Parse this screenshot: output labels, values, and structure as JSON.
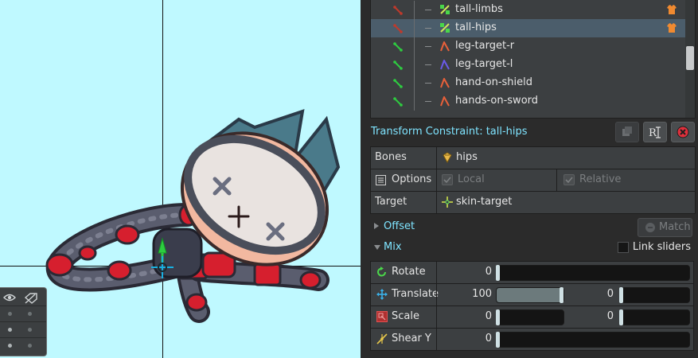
{
  "tree": {
    "items": [
      {
        "label": "tall-limbs",
        "icon": "transform-constraint-icon",
        "vis_color": "#c0392b",
        "skin": true
      },
      {
        "label": "tall-hips",
        "icon": "transform-constraint-icon",
        "vis_color": "#c0392b",
        "skin": true,
        "selected": true
      },
      {
        "label": "leg-target-r",
        "icon": "ik-constraint-icon",
        "vis_color": "#2ecc40"
      },
      {
        "label": "leg-target-l",
        "icon": "ik-constraint-icon",
        "vis_color": "#2ecc40"
      },
      {
        "label": "hand-on-shield",
        "icon": "ik-constraint-icon",
        "vis_color": "#2ecc40"
      },
      {
        "label": "hands-on-sword",
        "icon": "ik-constraint-icon",
        "vis_color": "#2ecc40"
      }
    ]
  },
  "title": {
    "text": "Transform Constraint: tall-hips",
    "buttons": [
      "duplicate-icon",
      "rename-icon",
      "delete-icon"
    ]
  },
  "props": {
    "bones_label": "Bones",
    "bones_value": "hips",
    "options_label": "Options",
    "local_label": "Local",
    "relative_label": "Relative",
    "target_label": "Target",
    "target_value": "skin-target"
  },
  "offset": {
    "label": "Offset",
    "match_label": "Match"
  },
  "mix": {
    "label": "Mix",
    "link_label": "Link sliders",
    "rows": [
      {
        "label": "Rotate",
        "value": "0"
      },
      {
        "label": "Translate",
        "value": "100",
        "value2": "0",
        "fill": 1.0
      },
      {
        "label": "Scale",
        "value": "0",
        "value2": "0"
      },
      {
        "label": "Shear Y",
        "value": "0"
      }
    ]
  },
  "colors": {
    "accent": "#7fe4ff",
    "viewport_bg": "#bff9ff",
    "selected_row": "#4b5d6b",
    "delete": "#e0303c"
  }
}
